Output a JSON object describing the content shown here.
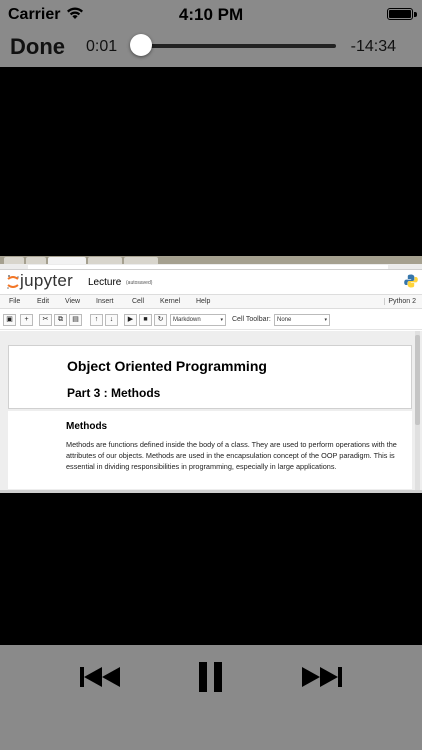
{
  "status_bar": {
    "carrier": "Carrier",
    "time": "4:10 PM",
    "icons": [
      "wifi-icon",
      "battery-icon"
    ]
  },
  "player": {
    "done_label": "Done",
    "elapsed": "0:01",
    "remaining": "-14:34",
    "progress_fraction": 0.001,
    "controls": [
      "rewind-icon",
      "pause-icon",
      "fast-forward-icon"
    ],
    "colors": {
      "bar": "#8a8a8a",
      "track": "#222222",
      "thumb": "#ffffff"
    }
  },
  "video_frame": {
    "app": {
      "brand": "jupyter",
      "notebook_name": "Lecture",
      "save_status": "(autosaved)",
      "kernel": "Python 2"
    },
    "menu": [
      "File",
      "Edit",
      "View",
      "Insert",
      "Cell",
      "Kernel",
      "Help"
    ],
    "toolbar": {
      "cell_type": "Markdown",
      "cell_toolbar_label": "Cell Toolbar:",
      "cell_toolbar_value": "None",
      "icons": [
        "save-icon",
        "plus-icon",
        "cut-icon",
        "copy-icon",
        "paste-icon",
        "arrow-up-icon",
        "arrow-down-icon",
        "run-icon",
        "stop-icon",
        "restart-icon"
      ]
    },
    "content": {
      "title": "Object Oriented Programming",
      "subtitle": "Part 3 : Methods",
      "section_heading": "Methods",
      "paragraph": "Methods are functions defined inside the body of a class. They are used to perform operations with the attributes of our objects. Methods are used in the encapsulation concept of the OOP paradigm. This is essential in dividing responsibilities in programming, especially in large applications."
    },
    "colors": {
      "jupyter_orange": "#f37626",
      "python_blue": "#3776ab",
      "python_yellow": "#ffd43b"
    }
  }
}
